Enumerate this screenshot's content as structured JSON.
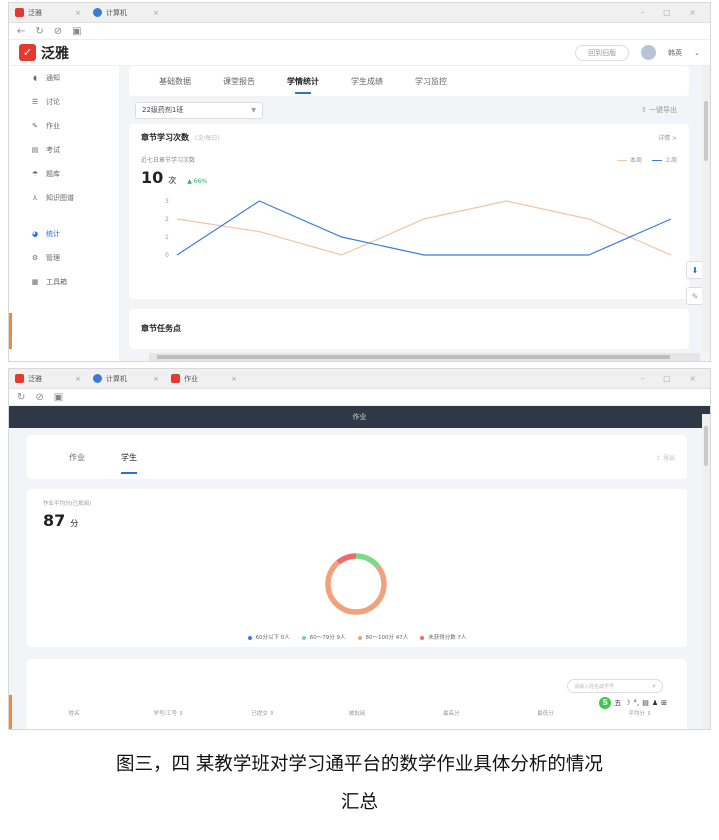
{
  "shot1": {
    "browser_tabs": [
      {
        "label": "泛雅",
        "icon": "fanya-icon",
        "color": "#e23a2f"
      },
      {
        "label": "计算机",
        "icon": "globe-icon",
        "color": "#3a7bd5"
      }
    ],
    "logo": "泛雅",
    "header": {
      "pill": "回到旧版",
      "user": "韩英"
    },
    "sidebar": [
      {
        "label": "通知",
        "icon": "notice-icon"
      },
      {
        "label": "讨论",
        "icon": "discussion-icon"
      },
      {
        "label": "作业",
        "icon": "homework-icon"
      },
      {
        "label": "考试",
        "icon": "exam-icon"
      },
      {
        "label": "题库",
        "icon": "question-bank-icon"
      },
      {
        "label": "知识图谱",
        "icon": "knowledge-graph-icon"
      },
      {
        "label": "统计",
        "icon": "stats-icon",
        "active": true
      },
      {
        "label": "管理",
        "icon": "manage-icon"
      },
      {
        "label": "工具箱",
        "icon": "toolbox-icon"
      }
    ],
    "subtabs": [
      "基础数据",
      "课堂报告",
      "学情统计",
      "学生成绩",
      "学习监控"
    ],
    "active_subtab": 2,
    "class_select": "22级药剂1班",
    "export_all": "一键导出",
    "study_card": {
      "title": "章节学习次数",
      "subtitle": "(次/每日)",
      "details": "详情 >",
      "stat_label": "近七日章节学习次数",
      "value": "10",
      "unit": "次",
      "delta": "▲ 66%"
    },
    "next_card_title": "章节任务点",
    "chart_data": {
      "type": "line",
      "x": [
        1,
        2,
        3,
        4,
        5,
        6,
        7
      ],
      "ylim": [
        0,
        3
      ],
      "yticks": [
        "3",
        "2",
        "1",
        "0"
      ],
      "series": [
        {
          "name": "本周",
          "color": "#f0c5a4",
          "values": [
            2,
            1.3,
            0,
            2,
            3,
            2,
            0
          ]
        },
        {
          "name": "上周",
          "color": "#3b7be0",
          "values": [
            0,
            3,
            1,
            0,
            0,
            0,
            2
          ]
        }
      ]
    }
  },
  "shot2": {
    "browser_tabs": [
      {
        "label": "泛雅",
        "icon": "fanya-icon",
        "color": "#e23a2f"
      },
      {
        "label": "计算机",
        "icon": "globe-icon",
        "color": "#3a7bd5"
      },
      {
        "label": "作业",
        "icon": "fanya-icon",
        "color": "#e23a2f"
      }
    ],
    "top_title": "作业",
    "tabs": [
      "作业",
      "学生"
    ],
    "active_tab": 1,
    "export": "导出",
    "avg_label": "作业平均分(已批阅)",
    "avg_value": "87",
    "avg_unit": "分",
    "search_placeholder": "请输入姓名或学号",
    "table_headers": [
      "姓名",
      "学号/工号 ⇕",
      "已提交 ⇕",
      "被批阅",
      "最高分",
      "最低分",
      "平均分 ⇕"
    ],
    "ime_label": "五",
    "chart_data": {
      "type": "pie",
      "categories": [
        "60分以下",
        "60～79分",
        "80～100分",
        "未获得分数"
      ],
      "labels": [
        "60分以下 0人",
        "60～79分 9人",
        "80～100分 47人",
        "未获得分数 7人"
      ],
      "values": [
        0,
        9,
        47,
        7
      ],
      "colors": [
        "#3b7be0",
        "#7fd88a",
        "#f0a27c",
        "#ef6b6b"
      ]
    }
  },
  "caption": {
    "line1": "图三，四 某教学班对学习通平台的数学作业具体分析的情况",
    "line2": "汇总"
  }
}
